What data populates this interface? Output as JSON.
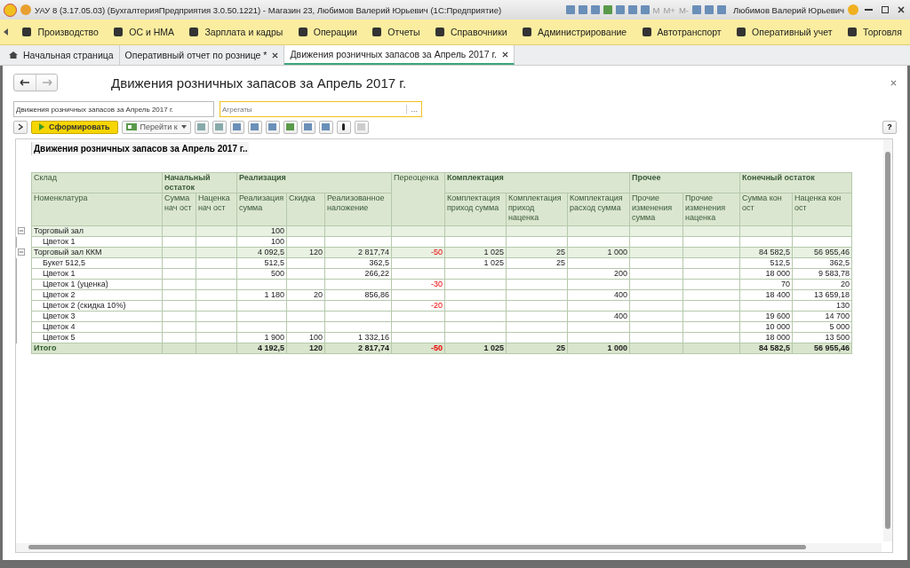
{
  "window": {
    "title": "УАУ 8 (3.17.05.03) (БухгалтерияПредприятия 3.0.50.1221) - Магазин 23, Любимов Валерий Юрьевич  (1С:Предприятие)",
    "memory_buttons": [
      "M",
      "M+",
      "M-"
    ],
    "user": "Любимов Валерий Юрьевич"
  },
  "sections": [
    {
      "label": "Производство"
    },
    {
      "label": "ОС и НМА"
    },
    {
      "label": "Зарплата и кадры"
    },
    {
      "label": "Операции"
    },
    {
      "label": "Отчеты"
    },
    {
      "label": "Справочники"
    },
    {
      "label": "Администрирование"
    },
    {
      "label": "Автотранспорт"
    },
    {
      "label": "Оперативный учет"
    },
    {
      "label": "Торговля"
    }
  ],
  "tabs": [
    {
      "label": "Начальная страница",
      "kind": "home",
      "selected": false
    },
    {
      "label": "Оперативный отчет по рознице *",
      "kind": "doc",
      "selected": false
    },
    {
      "label": "Движения розничных запасов за Апрель 2017 г.",
      "kind": "doc",
      "selected": true
    }
  ],
  "form": {
    "title": "Движения розничных запасов за Апрель 2017 г.",
    "report_name": "Движения розничных запасов за Апрель 2017 г.",
    "aggregates_placeholder": "Агрегаты",
    "choose_button": "...",
    "generate_button": "Сформировать",
    "goto_button": "Перейти к",
    "help_button": "?"
  },
  "report": {
    "title": "Движения розничных запасов за Апрель 2017 г..",
    "first_top": "Склад",
    "first_sub": "Номенклатура",
    "groups": [
      {
        "label": "Начальный остаток",
        "columns": [
          "Сумма нач ост",
          "Наценка нач ост"
        ]
      },
      {
        "label": "Реализация",
        "columns": [
          "Реализация сумма",
          "Скидка",
          "Реализованное наложение"
        ]
      },
      {
        "label": "Переоценка"
      },
      {
        "label": "Комплектация",
        "columns": [
          "Комплектация приход сумма",
          "Комплектация приход наценка",
          "Комплектация расход сумма"
        ]
      },
      {
        "label": "Прочее",
        "columns": [
          "Прочие изменения сумма",
          "Прочие изменения наценка"
        ]
      },
      {
        "label": "Конечный остаток",
        "columns": [
          "Сумма кон ост",
          "Наценка кон ост"
        ]
      }
    ],
    "rows": [
      {
        "kind": "group",
        "expanded": true,
        "name": "Торговый зал",
        "values": {
          "sale_sum": "100"
        },
        "children": [
          {
            "kind": "item",
            "name": "Цветок 1",
            "values": {
              "sale_sum": "100"
            }
          }
        ]
      },
      {
        "kind": "group",
        "expanded": true,
        "name": "Торговый зал ККМ",
        "values": {
          "sale_sum": "4 092,5",
          "discount": "120",
          "sale_markup": "2 817,74",
          "revaluation": "-50",
          "kit_in_sum": "1 025",
          "kit_in_markup": "25",
          "kit_out_sum": "1 000",
          "end_sum": "84 582,5",
          "end_markup": "56 955,46"
        },
        "children": [
          {
            "kind": "item",
            "name": "Букет 512,5",
            "values": {
              "sale_sum": "512,5",
              "sale_markup": "362,5",
              "kit_in_sum": "1 025",
              "kit_in_markup": "25",
              "end_sum": "512,5",
              "end_markup": "362,5"
            }
          },
          {
            "kind": "item",
            "name": "Цветок 1",
            "values": {
              "sale_sum": "500",
              "sale_markup": "266,22",
              "kit_out_sum": "200",
              "end_sum": "18 000",
              "end_markup": "9 583,78"
            }
          },
          {
            "kind": "item",
            "name": "Цветок 1 (уценка)",
            "values": {
              "revaluation": "-30",
              "end_sum": "70",
              "end_markup": "20"
            }
          },
          {
            "kind": "item",
            "name": "Цветок 2",
            "values": {
              "sale_sum": "1 180",
              "discount": "20",
              "sale_markup": "856,86",
              "kit_out_sum": "400",
              "end_sum": "18 400",
              "end_markup": "13 659,18"
            }
          },
          {
            "kind": "item",
            "name": "Цветок 2 (скидка 10%)",
            "values": {
              "revaluation": "-20",
              "end_markup": "130"
            }
          },
          {
            "kind": "item",
            "name": "Цветок 3",
            "values": {
              "kit_out_sum": "400",
              "end_sum": "19 600",
              "end_markup": "14 700"
            }
          },
          {
            "kind": "item",
            "name": "Цветок 4",
            "values": {
              "end_sum": "10 000",
              "end_markup": "5 000"
            }
          },
          {
            "kind": "item",
            "name": "Цветок 5",
            "values": {
              "sale_sum": "1 900",
              "discount": "100",
              "sale_markup": "1 332,16",
              "end_sum": "18 000",
              "end_markup": "13 500"
            }
          }
        ]
      },
      {
        "kind": "total",
        "name": "Итого",
        "values": {
          "sale_sum": "4 192,5",
          "discount": "120",
          "sale_markup": "2 817,74",
          "revaluation": "-50",
          "kit_in_sum": "1 025",
          "kit_in_markup": "25",
          "kit_out_sum": "1 000",
          "end_sum": "84 582,5",
          "end_markup": "56 955,46"
        }
      }
    ]
  }
}
